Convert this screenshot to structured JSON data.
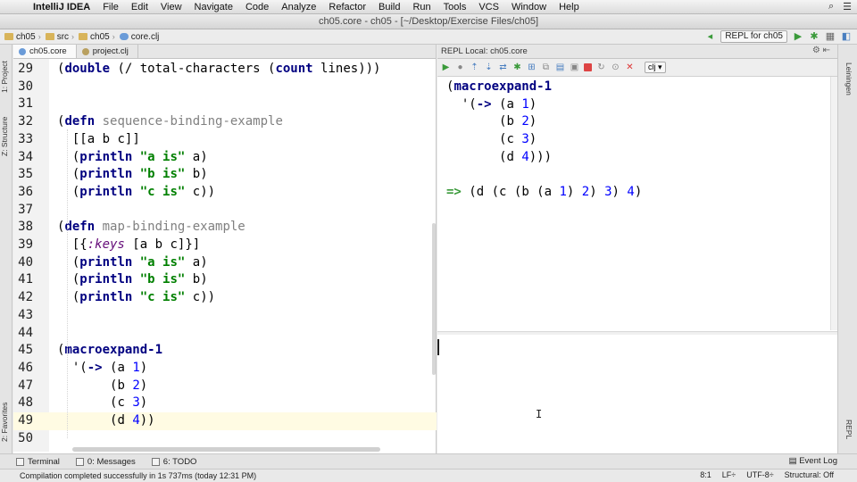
{
  "menubar": {
    "items": [
      "IntelliJ IDEA",
      "File",
      "Edit",
      "View",
      "Navigate",
      "Code",
      "Analyze",
      "Refactor",
      "Build",
      "Run",
      "Tools",
      "VCS",
      "Window",
      "Help"
    ]
  },
  "window": {
    "title": "ch05.core - ch05 - [~/Desktop/Exercise Files/ch05]"
  },
  "breadcrumbs": [
    "ch05",
    "src",
    "ch05",
    "core.clj"
  ],
  "run_config": {
    "label": "REPL for ch05"
  },
  "left_tabs": {
    "project": "1: Project",
    "structure": "Z: Structure",
    "favorites": "2: Favorites"
  },
  "right_tabs": {
    "leiningen": "Leiningen",
    "repl": "REPL"
  },
  "editor": {
    "tabs": [
      {
        "label": "ch05.core"
      },
      {
        "label": "project.clj"
      }
    ],
    "lines": [
      {
        "n": "29",
        "text": "(double (/ total-characters (count lines)))"
      },
      {
        "n": "30",
        "text": ""
      },
      {
        "n": "31",
        "text": ""
      },
      {
        "n": "32",
        "text": "(defn sequence-binding-example"
      },
      {
        "n": "33",
        "text": "  [[a b c]]"
      },
      {
        "n": "34",
        "text": "  (println \"a is\" a)"
      },
      {
        "n": "35",
        "text": "  (println \"b is\" b)"
      },
      {
        "n": "36",
        "text": "  (println \"c is\" c))"
      },
      {
        "n": "37",
        "text": ""
      },
      {
        "n": "38",
        "text": "(defn map-binding-example"
      },
      {
        "n": "39",
        "text": "  [{:keys [a b c]}]"
      },
      {
        "n": "40",
        "text": "  (println \"a is\" a)"
      },
      {
        "n": "41",
        "text": "  (println \"b is\" b)"
      },
      {
        "n": "42",
        "text": "  (println \"c is\" c))"
      },
      {
        "n": "43",
        "text": ""
      },
      {
        "n": "44",
        "text": ""
      },
      {
        "n": "45",
        "text": "(macroexpand-1"
      },
      {
        "n": "46",
        "text": "  '(-> (a 1)"
      },
      {
        "n": "47",
        "text": "       (b 2)"
      },
      {
        "n": "48",
        "text": "       (c 3)"
      },
      {
        "n": "49",
        "text": "       (d 4))"
      },
      {
        "n": "50",
        "text": ""
      }
    ]
  },
  "repl": {
    "title": "REPL Local: ch05.core",
    "language": "clj",
    "output": [
      "(macroexpand-1",
      "  '(-> (a 1)",
      "       (b 2)",
      "       (c 3)",
      "       (d 4)))",
      "",
      "=> (d (c (b (a 1) 2) 3) 4)"
    ]
  },
  "bottom_tools": {
    "terminal": "Terminal",
    "messages": "0: Messages",
    "todo": "6: TODO",
    "event_log": "Event Log"
  },
  "status": {
    "message": "Compilation completed successfully in 1s 737ms (today 12:31 PM)",
    "position": "8:1",
    "line_sep": "LF÷",
    "encoding": "UTF-8÷",
    "structural": "Structural: Off"
  }
}
